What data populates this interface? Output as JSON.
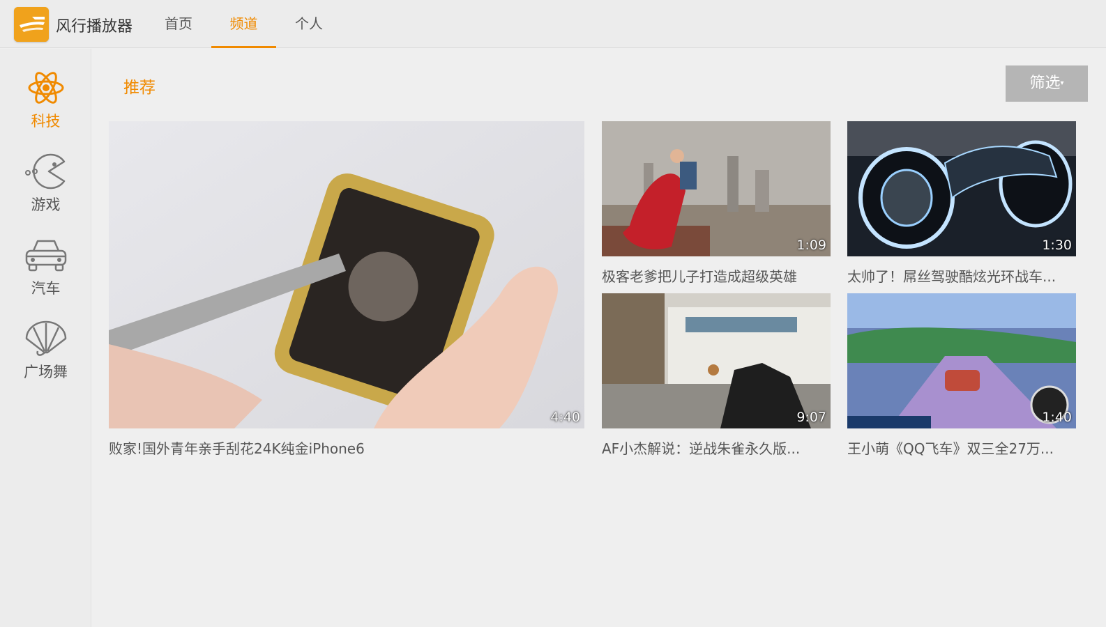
{
  "app": {
    "title": "风行播放器"
  },
  "nav": {
    "tabs": [
      {
        "label": "首页"
      },
      {
        "label": "频道"
      },
      {
        "label": "个人"
      }
    ],
    "active": "频道"
  },
  "sidebar": {
    "items": [
      {
        "label": "科技",
        "icon": "atom-icon",
        "active": true
      },
      {
        "label": "游戏",
        "icon": "pacman-icon",
        "active": false
      },
      {
        "label": "汽车",
        "icon": "car-icon",
        "active": false
      },
      {
        "label": "广场舞",
        "icon": "fan-icon",
        "active": false
      }
    ]
  },
  "content": {
    "section_title": "推荐",
    "filter_label": "筛选",
    "videos": [
      {
        "title": "败家!国外青年亲手刮花24K纯金iPhone6",
        "duration": "4:40"
      },
      {
        "title": "极客老爹把儿子打造成超级英雄",
        "duration": "1:09"
      },
      {
        "title": "太帅了！屌丝驾驶酷炫光环战车...",
        "duration": "1:30"
      },
      {
        "title": "AF小杰解说：逆战朱雀永久版...",
        "duration": "9:07"
      },
      {
        "title": "王小萌《QQ飞车》双三全27万...",
        "duration": "1:40"
      }
    ]
  },
  "colors": {
    "accent": "#f08a00",
    "filter_bg": "#b5b5b5"
  }
}
